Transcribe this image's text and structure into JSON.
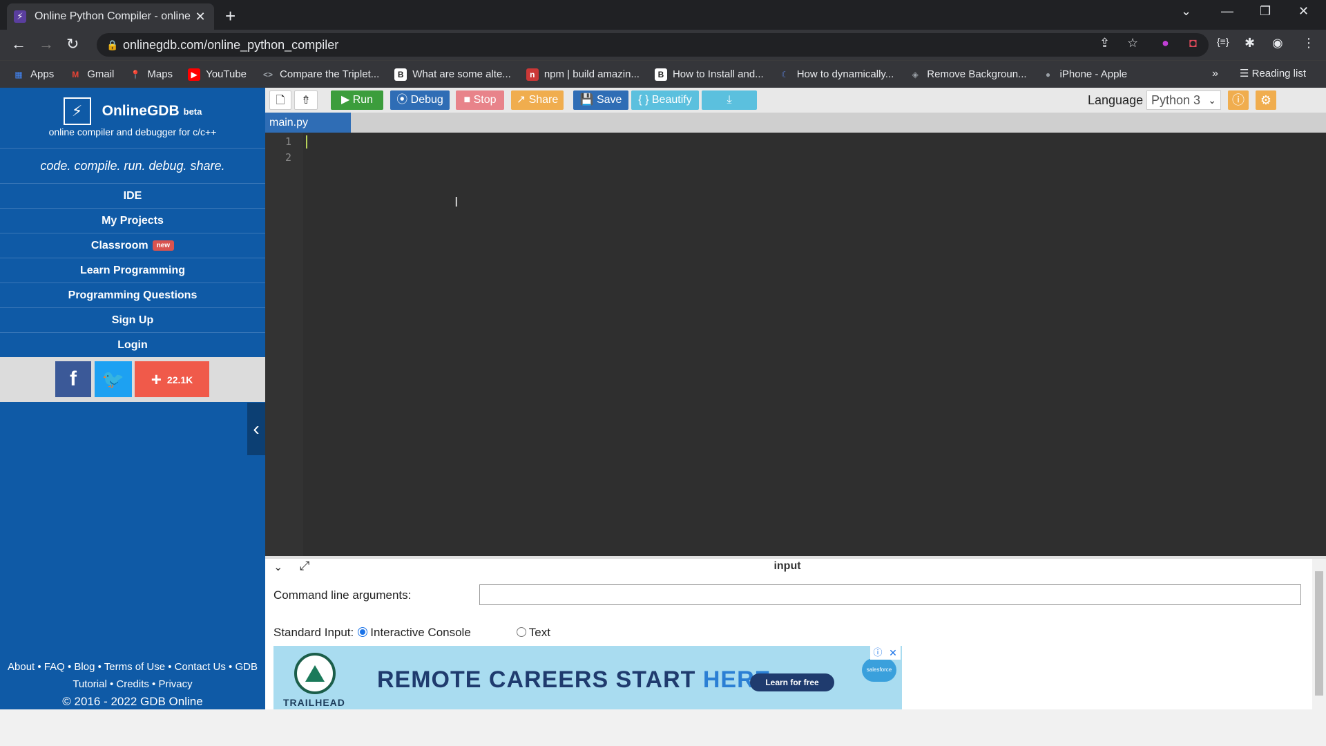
{
  "browser": {
    "tab_title": "Online Python Compiler - online",
    "url": "onlinegdb.com/online_python_compiler",
    "bookmarks": [
      {
        "label": "Apps",
        "icon": "apps-grid-icon",
        "color": "#4285f4"
      },
      {
        "label": "Gmail",
        "icon": "gmail-icon",
        "color": "#ea4335"
      },
      {
        "label": "Maps",
        "icon": "maps-pin-icon",
        "color": "#34a853"
      },
      {
        "label": "YouTube",
        "icon": "youtube-icon",
        "color": "#ff0000"
      },
      {
        "label": "Compare the Triplet...",
        "icon": "code-icon",
        "color": "#9aa0a6"
      },
      {
        "label": "What are some alte...",
        "icon": "b-icon",
        "color": "#3c3c3c"
      },
      {
        "label": "npm | build amazin...",
        "icon": "npm-icon",
        "color": "#cb3837"
      },
      {
        "label": "How to Install and...",
        "icon": "b-icon",
        "color": "#3c3c3c"
      },
      {
        "label": "How to dynamically...",
        "icon": "moon-icon",
        "color": "#5a7fd4"
      },
      {
        "label": "Remove Backgroun...",
        "icon": "layers-icon",
        "color": "#9aa0a6"
      },
      {
        "label": "iPhone - Apple",
        "icon": "apple-icon",
        "color": "#9aa0a6"
      }
    ],
    "reading_list": "Reading list"
  },
  "sidebar": {
    "brand": "OnlineGDB",
    "beta": "beta",
    "subtitle": "online compiler and debugger for c/c++",
    "slogan": "code. compile. run. debug. share.",
    "nav": [
      "IDE",
      "My Projects",
      "Classroom",
      "Learn Programming",
      "Programming Questions",
      "Sign Up",
      "Login"
    ],
    "new_badge": "new",
    "share_count": "22.1K",
    "footer_line1": "About • FAQ • Blog • Terms of Use • Contact Us • GDB",
    "footer_line2": "Tutorial • Credits • Privacy",
    "copyright": "© 2016 - 2022 GDB Online"
  },
  "toolbar": {
    "run": "Run",
    "debug": "Debug",
    "stop": "Stop",
    "share": "Share",
    "save": "Save",
    "beautify": "{ } Beautify",
    "language_label": "Language",
    "language_value": "Python 3"
  },
  "editor": {
    "file_tab": "main.py",
    "line_numbers": [
      "1",
      "2"
    ]
  },
  "io": {
    "title": "input",
    "cla_label": "Command line arguments:",
    "cla_value": "",
    "stdin_label": "Standard Input:",
    "opt_interactive": "Interactive Console",
    "opt_text": "Text"
  },
  "ad": {
    "brand": "TRAILHEAD",
    "headline_a": "REMOTE CAREERS START ",
    "headline_b": "HERE.",
    "cta": "Learn for free",
    "sponsor": "salesforce"
  },
  "colors": {
    "sidebar": "#0f5aa6",
    "run": "#3c9d3c",
    "debug": "#2f6db5",
    "stop": "#e8838a",
    "share": "#f0ad4e",
    "save": "#2f6db5",
    "beautify": "#5bc0de",
    "download": "#5bc0de"
  }
}
